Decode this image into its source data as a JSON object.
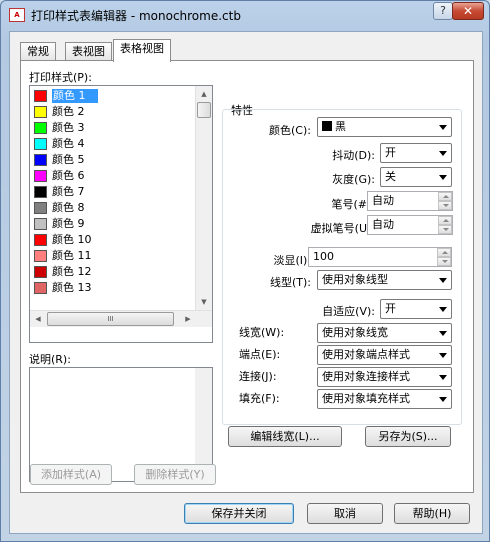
{
  "window": {
    "title": "打印样式表编辑器 - monochrome.ctb",
    "app_icon_text": "A",
    "help_glyph": "?",
    "close_glyph": "✕"
  },
  "tabs": [
    {
      "label": "常规"
    },
    {
      "label": "表视图"
    },
    {
      "label": "表格视图"
    }
  ],
  "styles_panel": {
    "label": "打印样式(P):",
    "items": [
      {
        "label": "颜色 1",
        "color": "#ff0000"
      },
      {
        "label": "颜色 2",
        "color": "#ffff00"
      },
      {
        "label": "颜色 3",
        "color": "#00ff00"
      },
      {
        "label": "颜色 4",
        "color": "#00ffff"
      },
      {
        "label": "颜色 5",
        "color": "#0000ff"
      },
      {
        "label": "颜色 6",
        "color": "#ff00ff"
      },
      {
        "label": "颜色 7",
        "color": "#000000"
      },
      {
        "label": "颜色 8",
        "color": "#808080"
      },
      {
        "label": "颜色 9",
        "color": "#c0c0c0"
      },
      {
        "label": "颜色 10",
        "color": "#ff0000"
      },
      {
        "label": "颜色 11",
        "color": "#ff7f7f"
      },
      {
        "label": "颜色 12",
        "color": "#cc0000"
      },
      {
        "label": "颜色 13",
        "color": "#e06666"
      }
    ],
    "selected_index": 0,
    "hscroll_grip": "III",
    "scroll_up": "▲",
    "scroll_down": "▼",
    "scroll_left": "◀",
    "scroll_right": "▶"
  },
  "description": {
    "label": "说明(R):"
  },
  "buttons": {
    "add_style": "添加样式(A)",
    "delete_style": "删除样式(Y)",
    "edit_lineweights": "编辑线宽(L)...",
    "save_as": "另存为(S)...",
    "save_close": "保存并关闭",
    "cancel": "取消",
    "help": "帮助(H)"
  },
  "properties": {
    "title": "特性",
    "color": {
      "label": "颜色(C):",
      "value": "黑"
    },
    "dither": {
      "label": "抖动(D):",
      "value": "开"
    },
    "grayscale": {
      "label": "灰度(G):",
      "value": "关"
    },
    "pen_number": {
      "label": "笔号(#):",
      "value": "自动"
    },
    "virtual_pen": {
      "label": "虚拟笔号(U):",
      "value": "自动"
    },
    "screening": {
      "label": "淡显(I):",
      "value": "100"
    },
    "linetype": {
      "label": "线型(T):",
      "value": "使用对象线型"
    },
    "adaptive": {
      "label": "自适应(V):",
      "value": "开"
    },
    "lineweight": {
      "label": "线宽(W):",
      "value": "使用对象线宽"
    },
    "line_end": {
      "label": "端点(E):",
      "value": "使用对象端点样式"
    },
    "line_join": {
      "label": "连接(J):",
      "value": "使用对象连接样式"
    },
    "fill": {
      "label": "填充(F):",
      "value": "使用对象填充样式"
    }
  }
}
